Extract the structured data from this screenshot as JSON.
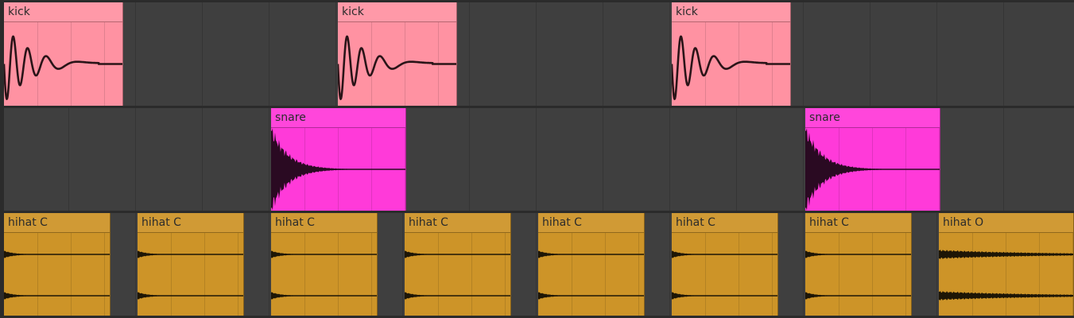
{
  "arrangement": {
    "tracks": [
      {
        "id": "kick",
        "color": "#ff92a2",
        "waveform": "kick",
        "clips": [
          {
            "label": "kick"
          },
          {
            "label": "kick"
          },
          {
            "label": "kick"
          }
        ]
      },
      {
        "id": "snare",
        "color": "#ff3ad9",
        "waveform": "snare",
        "clips": [
          {
            "label": "snare"
          },
          {
            "label": "snare"
          }
        ]
      },
      {
        "id": "hihat",
        "color": "#cd9428",
        "waveform": "hihat",
        "clips": [
          {
            "label": "hihat C"
          },
          {
            "label": "hihat C"
          },
          {
            "label": "hihat C"
          },
          {
            "label": "hihat C"
          },
          {
            "label": "hihat C"
          },
          {
            "label": "hihat C"
          },
          {
            "label": "hihat C"
          },
          {
            "label": "hihat O"
          }
        ]
      }
    ]
  }
}
